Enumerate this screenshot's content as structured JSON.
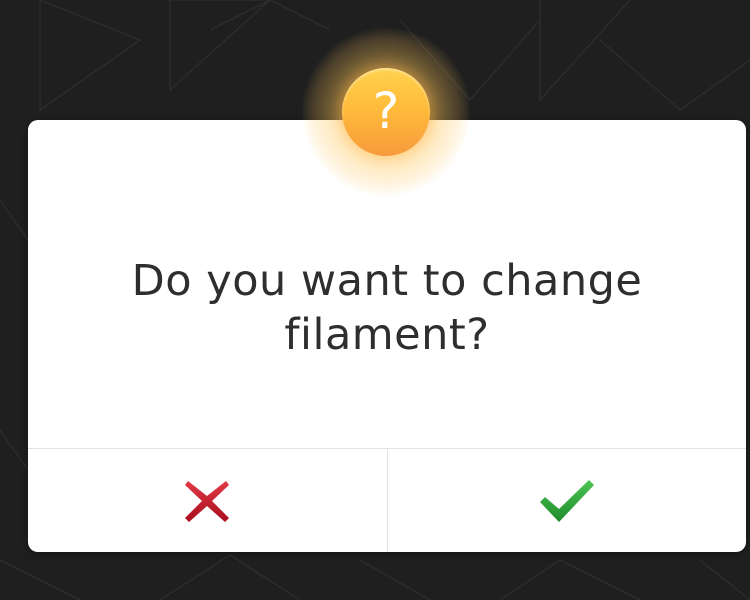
{
  "dialog": {
    "badge_glyph": "?",
    "message_line1": "Do you want to change",
    "message_line2": "filament?"
  },
  "buttons": {
    "cancel_icon": "close-icon",
    "confirm_icon": "checkmark-icon"
  },
  "colors": {
    "background": "#1f1f1f",
    "dialog": "#ffffff",
    "cancel": "#c8172a",
    "confirm": "#2fa83a",
    "badge": "#ffb93a"
  }
}
